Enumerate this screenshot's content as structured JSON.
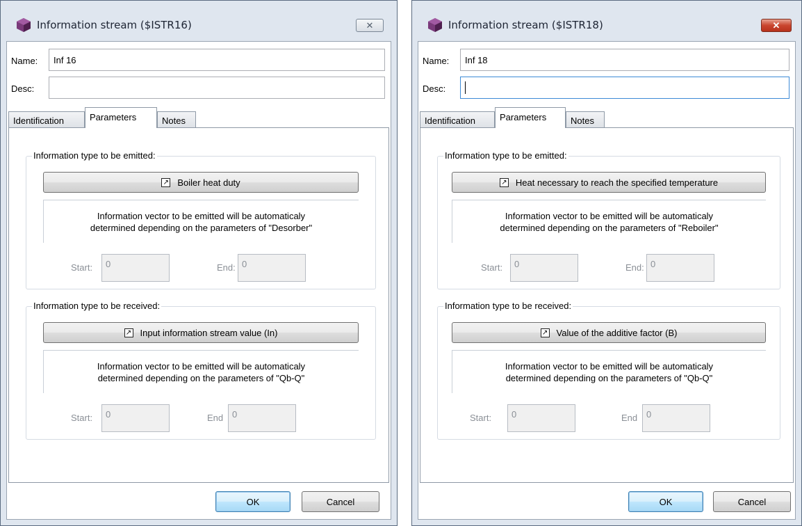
{
  "dialogs": [
    {
      "title": "Information stream ($ISTR16)",
      "close_glyph": "✕",
      "name_label": "Name:",
      "name_value": "Inf 16",
      "desc_label": "Desc:",
      "desc_value": "",
      "tabs": [
        "Identification",
        "Parameters",
        "Notes"
      ],
      "active_tab": "Parameters",
      "emitted": {
        "title": "Information type to be emitted:",
        "button_label": "Boiler heat duty",
        "info_line1": "Information vector to be emitted will be automaticaly",
        "info_line2": "determined depending on the parameters of \"Desorber\"",
        "start_label": "Start:",
        "start_value": "0",
        "end_label": "End:",
        "end_value": "0"
      },
      "received": {
        "title": "Information type to be received:",
        "button_label": "Input information stream value (In)",
        "info_line1": "Information vector to be emitted will be automaticaly",
        "info_line2": "determined depending on the parameters of \"Qb-Q\"",
        "start_label": "Start:",
        "start_value": "0",
        "end_label": "End",
        "end_value": "0"
      },
      "ok_label": "OK",
      "cancel_label": "Cancel"
    },
    {
      "title": "Information stream ($ISTR18)",
      "close_glyph": "✕",
      "name_label": "Name:",
      "name_value": "Inf 18",
      "desc_label": "Desc:",
      "desc_value": "",
      "tabs": [
        "Identification",
        "Parameters",
        "Notes"
      ],
      "active_tab": "Parameters",
      "emitted": {
        "title": "Information type to be emitted:",
        "button_label": "Heat necessary to reach the specified temperature",
        "info_line1": "Information vector to be emitted will be automaticaly",
        "info_line2": "determined depending on the parameters of \"Reboiler\"",
        "start_label": "Start:",
        "start_value": "0",
        "end_label": "End:",
        "end_value": "0"
      },
      "received": {
        "title": "Information type to be received:",
        "button_label": "Value of the additive factor (B)",
        "info_line1": "Information vector to be emitted will be automaticaly",
        "info_line2": "determined depending on the parameters of \"Qb-Q\"",
        "start_label": "Start:",
        "start_value": "0",
        "end_label": "End",
        "end_value": "0"
      },
      "ok_label": "OK",
      "cancel_label": "Cancel"
    }
  ],
  "colors": {
    "app_icon": "#6b2f6b",
    "window_frame": "#dfe6ef",
    "close_active": "#c9452e",
    "default_button": "#a7d9f5"
  },
  "icons": {
    "app": "app-cube-icon",
    "shortcut": "shortcut-arrow-icon",
    "close": "close-icon"
  }
}
